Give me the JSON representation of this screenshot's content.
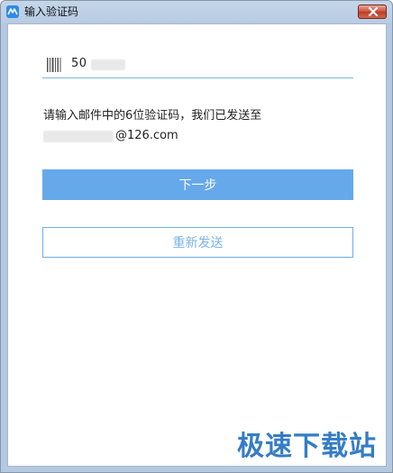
{
  "window": {
    "title": "输入验证码"
  },
  "account_field": {
    "value_visible": "50"
  },
  "hint": {
    "line1": "请输入邮件中的6位验证码，我们已发送至",
    "email_suffix": "@126.com"
  },
  "buttons": {
    "next_label": "下一步",
    "resend_label": "重新发送"
  },
  "watermark": {
    "text": "极速下载站"
  },
  "colors": {
    "accent": "#66a9ea",
    "outline": "#6aaee8",
    "watermark": "#1f6fc0"
  },
  "icons": {
    "app": "app-logo-icon",
    "close": "close-icon",
    "field": "barcode-icon"
  }
}
